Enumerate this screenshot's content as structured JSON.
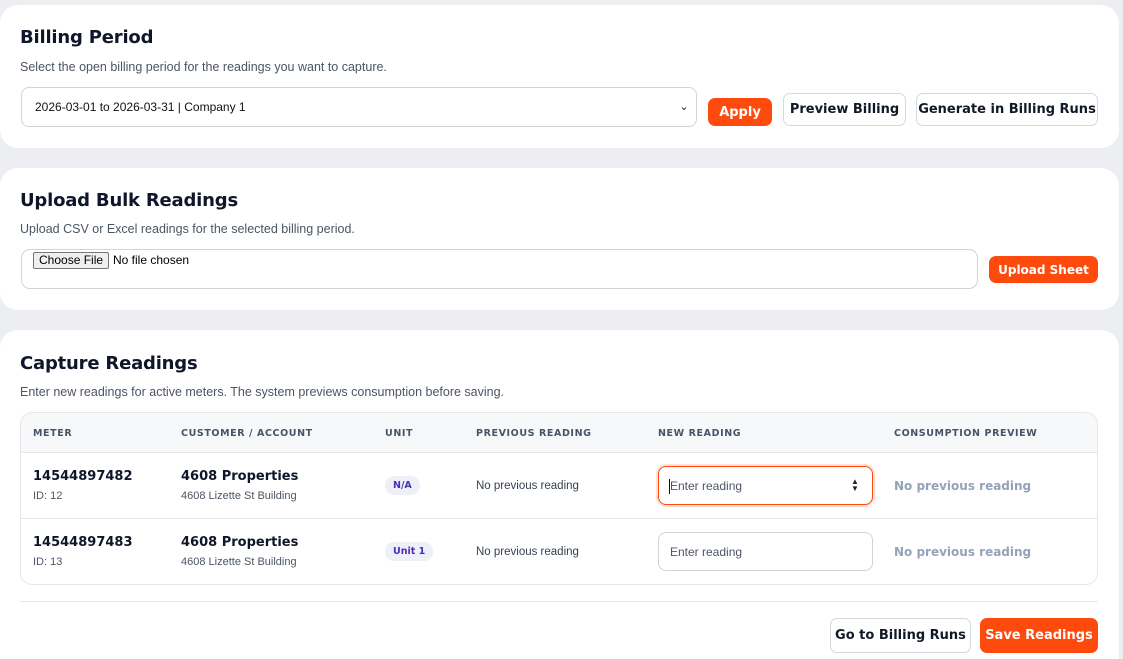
{
  "billing": {
    "title": "Billing Period",
    "subtitle": "Select the open billing period for the readings you want to capture.",
    "selected_period": "2026-03-01 to 2026-03-31 | Company 1",
    "apply_label": "Apply",
    "preview_label": "Preview Billing",
    "generate_label": "Generate in Billing Runs"
  },
  "upload": {
    "title": "Upload Bulk Readings",
    "subtitle": "Upload CSV or Excel readings for the selected billing period.",
    "choose_file_label": "Choose File",
    "file_status": "No file chosen",
    "upload_label": "Upload Sheet"
  },
  "capture": {
    "title": "Capture Readings",
    "subtitle": "Enter new readings for active meters. The system previews consumption before saving.",
    "columns": [
      "METER",
      "CUSTOMER / ACCOUNT",
      "UNIT",
      "PREVIOUS READING",
      "NEW READING",
      "CONSUMPTION PREVIEW"
    ],
    "rows": [
      {
        "meter": "14544897482",
        "meter_id": "ID: 12",
        "customer": "4608 Properties",
        "account": "4608 Lizette St Building",
        "unit": "N/A",
        "previous": "No previous reading",
        "new_placeholder": "Enter reading",
        "consumption": "No previous reading"
      },
      {
        "meter": "14544897483",
        "meter_id": "ID: 13",
        "customer": "4608 Properties",
        "account": "4608 Lizette St Building",
        "unit": "Unit 1",
        "previous": "No previous reading",
        "new_placeholder": "Enter reading",
        "consumption": "No previous reading"
      }
    ],
    "go_billing_label": "Go to Billing Runs",
    "save_label": "Save Readings"
  },
  "colors": {
    "accent": "#ff4a0e",
    "badge_text": "#4f2bbd",
    "muted": "#94a3b8"
  },
  "icons": {
    "select": "chevron-down-icon",
    "stepper": "stepper-arrows-icon"
  }
}
